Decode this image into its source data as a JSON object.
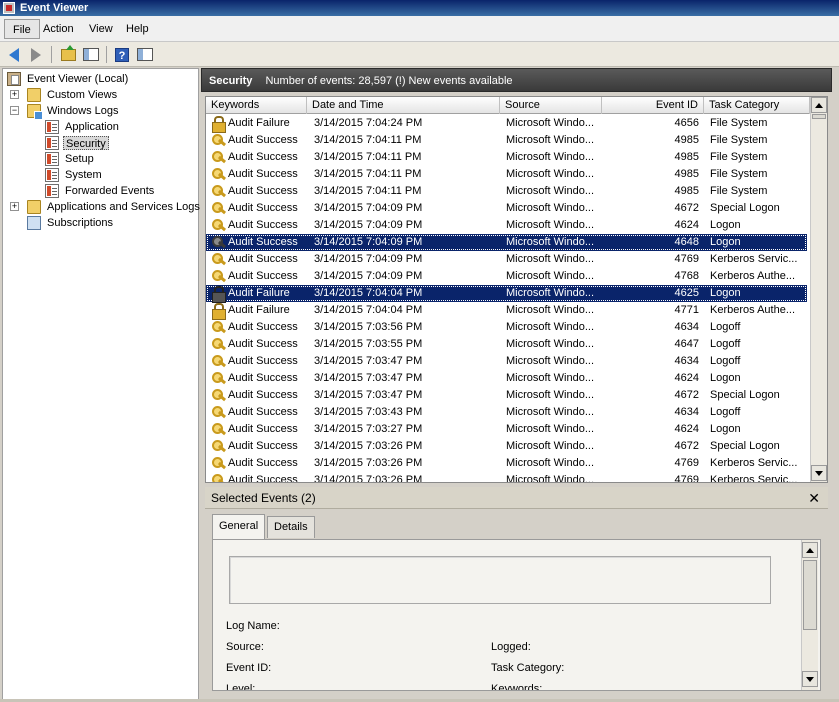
{
  "window": {
    "title": "Event Viewer"
  },
  "menu": [
    "File",
    "Action",
    "View",
    "Help"
  ],
  "toolbar": {
    "buttons": [
      "back-icon",
      "forward-icon",
      "up-folder-icon",
      "show-hide-tree-icon",
      "help-icon",
      "action-pane-icon"
    ]
  },
  "tree": {
    "root": "Event Viewer (Local)",
    "custom_views": "Custom Views",
    "windows_logs": "Windows Logs",
    "logs": [
      "Application",
      "Security",
      "Setup",
      "System",
      "Forwarded Events"
    ],
    "apps_services": "Applications and Services Logs",
    "subscriptions": "Subscriptions",
    "selected": "Security"
  },
  "header": {
    "title": "Security",
    "summary": "Number of events: 28,597 (!) New events available"
  },
  "grid": {
    "columns": [
      "Keywords",
      "Date and Time",
      "Source",
      "Event ID",
      "Task Category"
    ],
    "rows": [
      {
        "kw": "Audit Failure",
        "dt": "3/14/2015 7:04:24 PM",
        "src": "Microsoft Windo...",
        "id": "4656",
        "cat": "File System",
        "icon": "lock",
        "selected": false
      },
      {
        "kw": "Audit Success",
        "dt": "3/14/2015 7:04:11 PM",
        "src": "Microsoft Windo...",
        "id": "4985",
        "cat": "File System",
        "icon": "key",
        "selected": false
      },
      {
        "kw": "Audit Success",
        "dt": "3/14/2015 7:04:11 PM",
        "src": "Microsoft Windo...",
        "id": "4985",
        "cat": "File System",
        "icon": "key",
        "selected": false
      },
      {
        "kw": "Audit Success",
        "dt": "3/14/2015 7:04:11 PM",
        "src": "Microsoft Windo...",
        "id": "4985",
        "cat": "File System",
        "icon": "key",
        "selected": false
      },
      {
        "kw": "Audit Success",
        "dt": "3/14/2015 7:04:11 PM",
        "src": "Microsoft Windo...",
        "id": "4985",
        "cat": "File System",
        "icon": "key",
        "selected": false
      },
      {
        "kw": "Audit Success",
        "dt": "3/14/2015 7:04:09 PM",
        "src": "Microsoft Windo...",
        "id": "4672",
        "cat": "Special Logon",
        "icon": "key",
        "selected": false
      },
      {
        "kw": "Audit Success",
        "dt": "3/14/2015 7:04:09 PM",
        "src": "Microsoft Windo...",
        "id": "4624",
        "cat": "Logon",
        "icon": "key",
        "selected": false
      },
      {
        "kw": "Audit Success",
        "dt": "3/14/2015 7:04:09 PM",
        "src": "Microsoft Windo...",
        "id": "4648",
        "cat": "Logon",
        "icon": "key",
        "selected": true
      },
      {
        "kw": "Audit Success",
        "dt": "3/14/2015 7:04:09 PM",
        "src": "Microsoft Windo...",
        "id": "4769",
        "cat": "Kerberos Servic...",
        "icon": "key",
        "selected": false
      },
      {
        "kw": "Audit Success",
        "dt": "3/14/2015 7:04:09 PM",
        "src": "Microsoft Windo...",
        "id": "4768",
        "cat": "Kerberos Authe...",
        "icon": "key",
        "selected": false
      },
      {
        "kw": "Audit Failure",
        "dt": "3/14/2015 7:04:04 PM",
        "src": "Microsoft Windo...",
        "id": "4625",
        "cat": "Logon",
        "icon": "lock",
        "selected": true
      },
      {
        "kw": "Audit Failure",
        "dt": "3/14/2015 7:04:04 PM",
        "src": "Microsoft Windo...",
        "id": "4771",
        "cat": "Kerberos Authe...",
        "icon": "lock",
        "selected": false
      },
      {
        "kw": "Audit Success",
        "dt": "3/14/2015 7:03:56 PM",
        "src": "Microsoft Windo...",
        "id": "4634",
        "cat": "Logoff",
        "icon": "key",
        "selected": false
      },
      {
        "kw": "Audit Success",
        "dt": "3/14/2015 7:03:55 PM",
        "src": "Microsoft Windo...",
        "id": "4647",
        "cat": "Logoff",
        "icon": "key",
        "selected": false
      },
      {
        "kw": "Audit Success",
        "dt": "3/14/2015 7:03:47 PM",
        "src": "Microsoft Windo...",
        "id": "4634",
        "cat": "Logoff",
        "icon": "key",
        "selected": false
      },
      {
        "kw": "Audit Success",
        "dt": "3/14/2015 7:03:47 PM",
        "src": "Microsoft Windo...",
        "id": "4624",
        "cat": "Logon",
        "icon": "key",
        "selected": false
      },
      {
        "kw": "Audit Success",
        "dt": "3/14/2015 7:03:47 PM",
        "src": "Microsoft Windo...",
        "id": "4672",
        "cat": "Special Logon",
        "icon": "key",
        "selected": false
      },
      {
        "kw": "Audit Success",
        "dt": "3/14/2015 7:03:43 PM",
        "src": "Microsoft Windo...",
        "id": "4634",
        "cat": "Logoff",
        "icon": "key",
        "selected": false
      },
      {
        "kw": "Audit Success",
        "dt": "3/14/2015 7:03:27 PM",
        "src": "Microsoft Windo...",
        "id": "4624",
        "cat": "Logon",
        "icon": "key",
        "selected": false
      },
      {
        "kw": "Audit Success",
        "dt": "3/14/2015 7:03:26 PM",
        "src": "Microsoft Windo...",
        "id": "4672",
        "cat": "Special Logon",
        "icon": "key",
        "selected": false
      },
      {
        "kw": "Audit Success",
        "dt": "3/14/2015 7:03:26 PM",
        "src": "Microsoft Windo...",
        "id": "4769",
        "cat": "Kerberos Servic...",
        "icon": "key",
        "selected": false
      },
      {
        "kw": "Audit Success",
        "dt": "3/14/2015 7:03:26 PM",
        "src": "Microsoft Windo...",
        "id": "4769",
        "cat": "Kerberos Servic...",
        "icon": "key",
        "selected": false
      }
    ]
  },
  "details": {
    "title": "Selected Events (2)",
    "close": "✕",
    "tabs": [
      "General",
      "Details"
    ],
    "active_tab": "General",
    "fields": {
      "log_name": "Log Name:",
      "source": "Source:",
      "logged": "Logged:",
      "event_id": "Event ID:",
      "task_category": "Task Category:",
      "level": "Level:",
      "keywords": "Keywords:"
    }
  },
  "colors": {
    "selection": "#0a246a",
    "header_bg": "#3a3a3a",
    "audit_success_icon": "#c99a1c"
  }
}
